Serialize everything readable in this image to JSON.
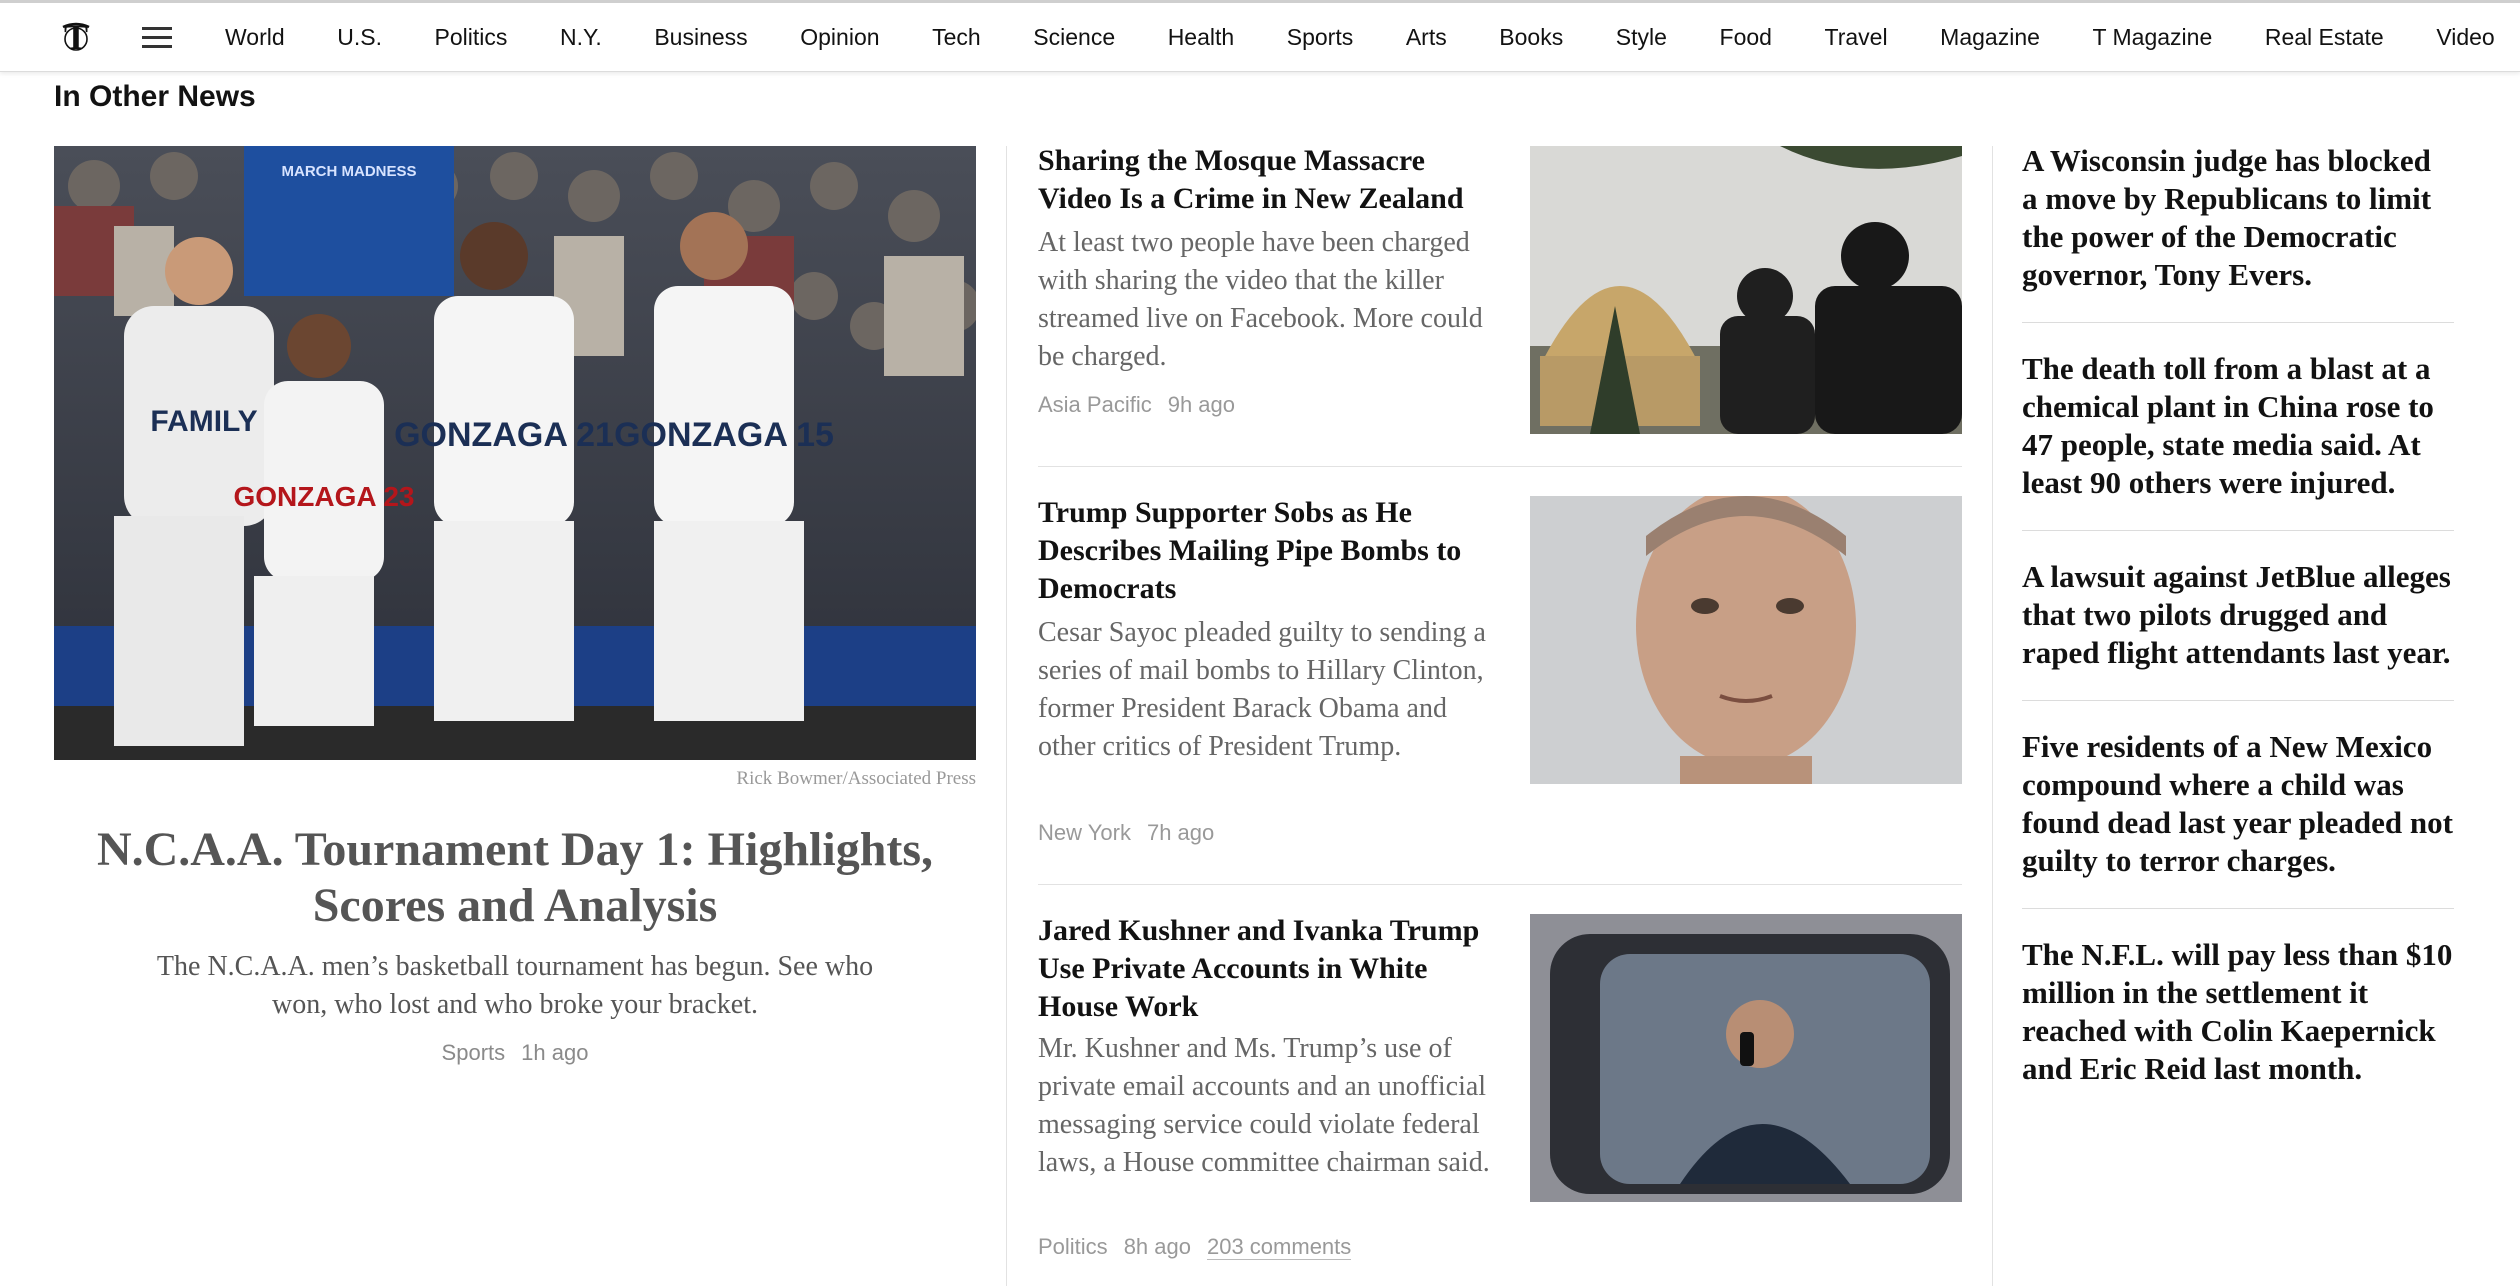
{
  "nav": {
    "sections": [
      "World",
      "U.S.",
      "Politics",
      "N.Y.",
      "Business",
      "Opinion",
      "Tech",
      "Science",
      "Health",
      "Sports",
      "Arts",
      "Books",
      "Style",
      "Food",
      "Travel",
      "Magazine",
      "T Magazine",
      "Real Estate",
      "Video"
    ]
  },
  "section_title": "In Other News",
  "hero": {
    "credit": "Rick Bowmer/Associated Press",
    "headline": "N.C.A.A. Tournament Day 1: Highlights, Scores and Analysis",
    "summary": "The N.C.A.A. men’s basketball tournament has begun. See who won, who lost and who broke your bracket.",
    "section": "Sports",
    "time": "1h ago",
    "image_text": {
      "banner": "MARCH MADNESS",
      "jerseys": [
        "FAMILY",
        "GONZAGA 23",
        "GONZAGA 21",
        "GONZAGA 15"
      ]
    }
  },
  "stories": [
    {
      "headline": "Sharing the Mosque Massacre Video Is a Crime in New Zealand",
      "summary": "At least two people have been charged with sharing the video that the killer streamed live on Facebook. More could be charged.",
      "section": "Asia Pacific",
      "time": "9h ago"
    },
    {
      "headline": "Trump Supporter Sobs as He Describes Mailing Pipe Bombs to Democrats",
      "summary": "Cesar Sayoc pleaded guilty to sending a series of mail bombs to Hillary Clinton, former President Barack Obama and other critics of President Trump.",
      "section": "New York",
      "time": "7h ago"
    },
    {
      "headline": "Jared Kushner and Ivanka Trump Use Private Accounts in White House Work",
      "summary": "Mr. Kushner and Ms. Trump’s use of private email accounts and an unofficial messaging service could violate federal laws, a House committee chairman said.",
      "section": "Politics",
      "time": "8h ago",
      "comments": "203 comments"
    }
  ],
  "briefs": [
    "A Wisconsin judge has blocked a move by Republicans to limit the power of the Democratic governor, Tony Evers.",
    "The death toll from a blast at a chemical plant in China rose to 47 people, state media said. At least 90 others were injured.",
    "A lawsuit against JetBlue alleges that two pilots drugged and raped flight attendants last year.",
    "Five residents of a New Mexico compound where a child was found dead last year pleaded not guilty to terror charges.",
    "The N.F.L. will pay less than $10 million in the settlement it reached with Colin Kaepernick and Eric Reid last month."
  ]
}
